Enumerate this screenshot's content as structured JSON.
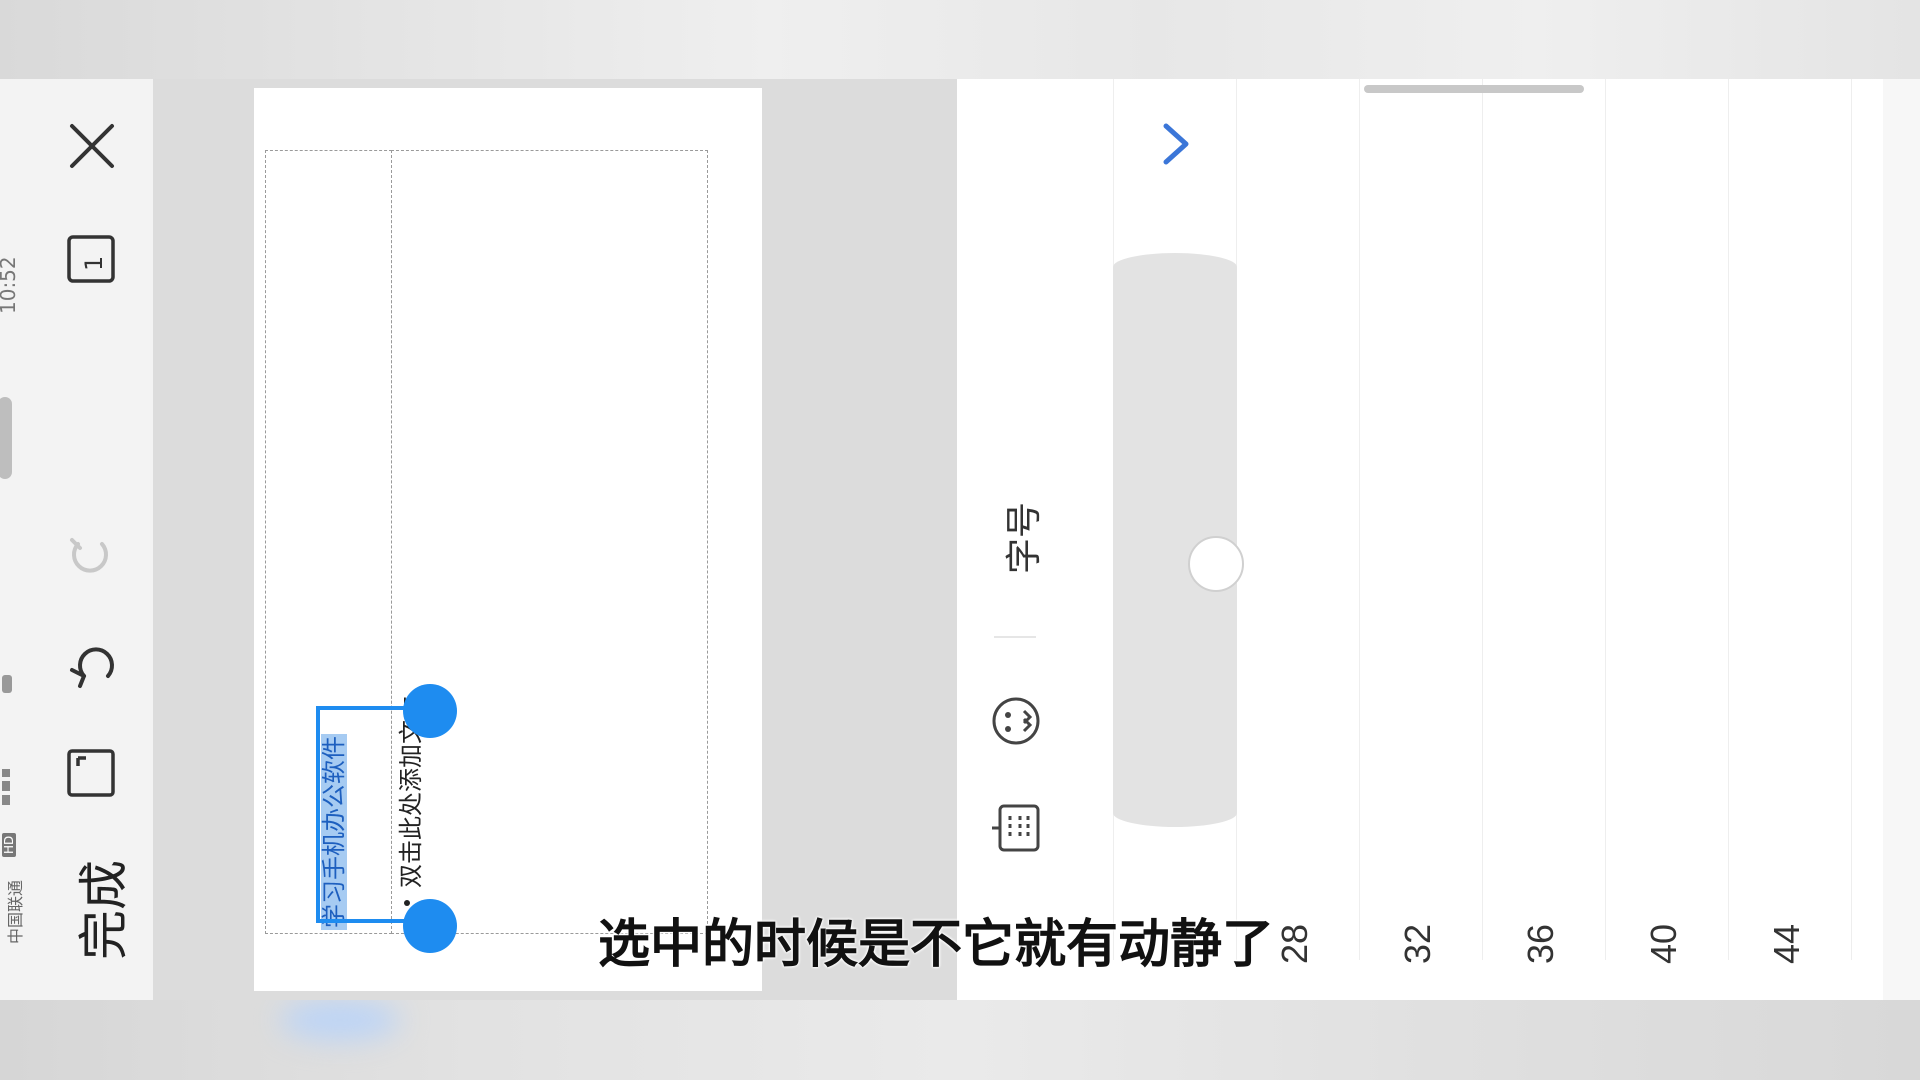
{
  "status_bar": {
    "carrier": "中国联通",
    "hd_badge": "HD",
    "time": "10:52"
  },
  "left_toolbar": {
    "done_label": "完成",
    "page_count": "1",
    "icons": [
      "close-icon",
      "page-count-icon",
      "redo-icon",
      "undo-icon",
      "fit-screen-icon"
    ]
  },
  "document": {
    "selected_text": "学习手机办公软件",
    "placeholder_text": "双击此处添加文本"
  },
  "toolbar": {
    "font_size_label": "字号",
    "icons": [
      "expand-chevron-icon",
      "emoji-icon",
      "keyboard-icon"
    ]
  },
  "font_panel": {
    "sizes": [
      "28",
      "32",
      "36",
      "40",
      "44"
    ]
  },
  "subtitle": "选中的时候是不它就有动静了",
  "colors": {
    "accent": "#1e8cf0",
    "selection": "#a6cbf2",
    "chevron": "#3b76d8"
  }
}
